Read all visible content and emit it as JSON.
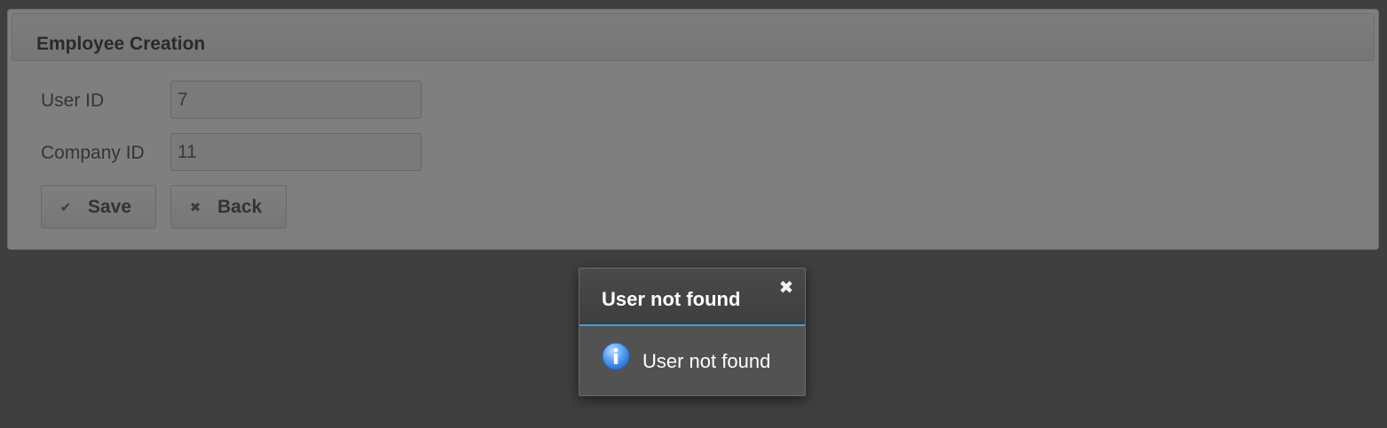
{
  "form": {
    "title": "Employee Creation",
    "fields": [
      {
        "label": "User ID",
        "value": "7"
      },
      {
        "label": "Company ID",
        "value": "11"
      }
    ],
    "buttons": {
      "save": {
        "label": "Save",
        "icon": "check-icon"
      },
      "back": {
        "label": "Back",
        "icon": "close-icon"
      }
    }
  },
  "dialog": {
    "title": "User not found",
    "message": "User not found",
    "icon": "info-icon",
    "accent_color": "#3c9fe0"
  }
}
